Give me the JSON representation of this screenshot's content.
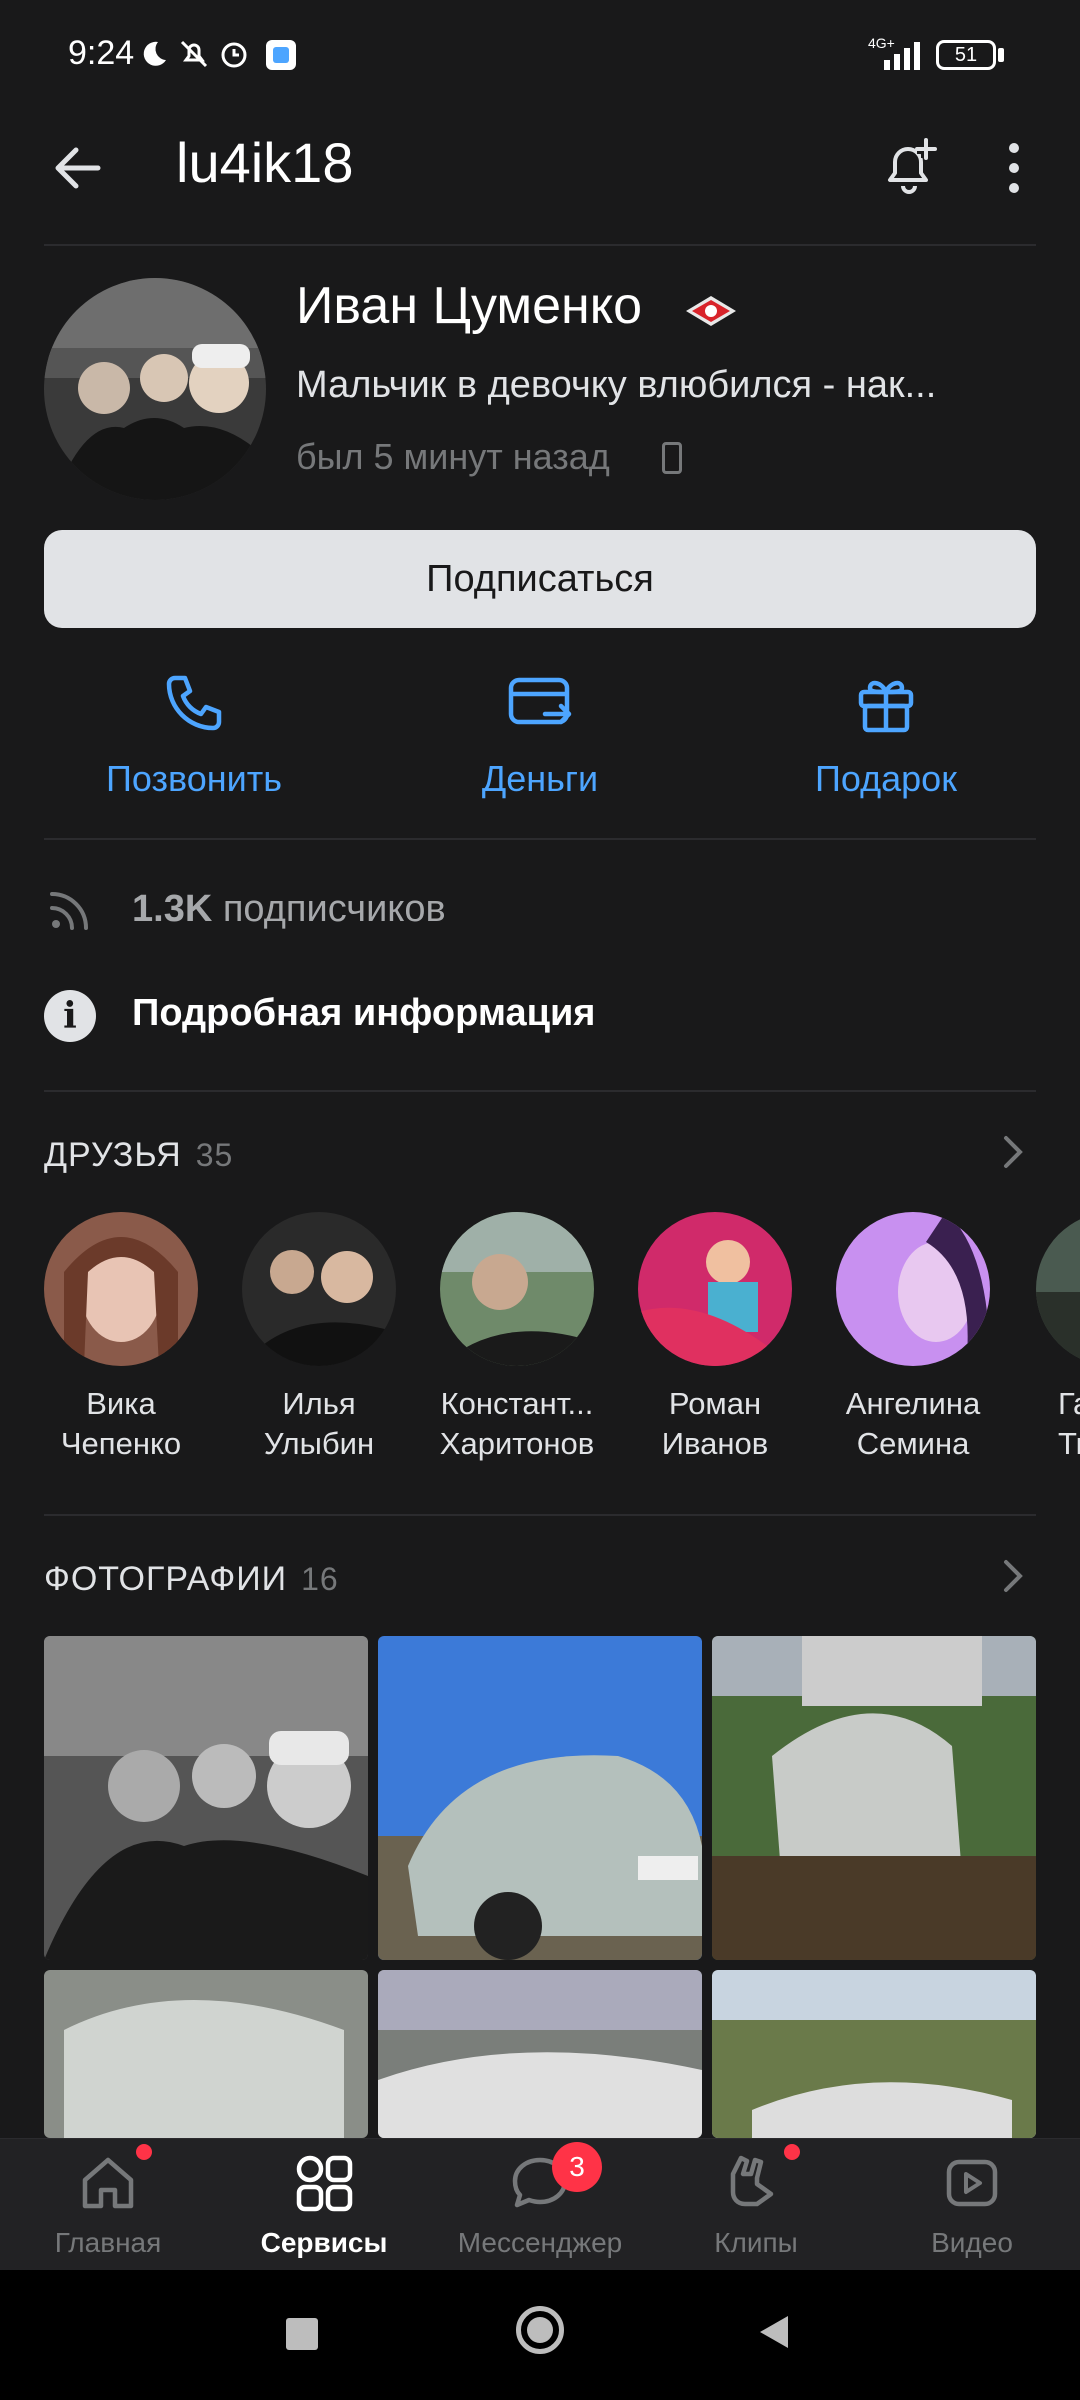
{
  "status_bar": {
    "time": "9:24",
    "network": "4G+",
    "battery": "51"
  },
  "header": {
    "title": "lu4ik18"
  },
  "profile": {
    "name": "Иван Цуменко",
    "status": "Мальчик в девочку влюбился - нак...",
    "last_seen": "был 5 минут назад",
    "subscribe_label": "Подписаться"
  },
  "actions": [
    {
      "label": "Позвонить",
      "icon": "phone-icon"
    },
    {
      "label": "Деньги",
      "icon": "money-transfer-icon"
    },
    {
      "label": "Подарок",
      "icon": "gift-icon"
    }
  ],
  "followers": {
    "count": "1.3K",
    "label": "подписчиков"
  },
  "info": {
    "label": "Подробная информация"
  },
  "friends": {
    "title": "ДРУЗЬЯ",
    "count": "35",
    "items": [
      {
        "first": "Вика",
        "last": "Чепенко"
      },
      {
        "first": "Илья",
        "last": "Улыбин"
      },
      {
        "first": "Констант...",
        "last": "Харитонов"
      },
      {
        "first": "Роман",
        "last": "Иванов"
      },
      {
        "first": "Ангелина",
        "last": "Семина"
      },
      {
        "first": "Га",
        "last": "Ти"
      }
    ]
  },
  "photos": {
    "title": "ФОТОГРАФИИ",
    "count": "16"
  },
  "tabbar": {
    "items": [
      {
        "label": "Главная",
        "icon": "home-icon"
      },
      {
        "label": "Сервисы",
        "icon": "services-icon"
      },
      {
        "label": "Мессенджер",
        "icon": "messenger-icon",
        "badge": "3"
      },
      {
        "label": "Клипы",
        "icon": "clips-icon"
      },
      {
        "label": "Видео",
        "icon": "video-icon"
      }
    ]
  },
  "colors": {
    "background": "#19191a",
    "accent": "#4da5ff",
    "badge": "#ff3347"
  }
}
